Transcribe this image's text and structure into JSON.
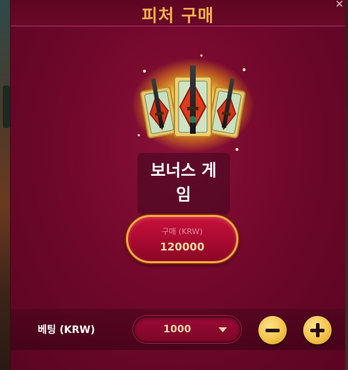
{
  "dialog": {
    "title": "피처 구매",
    "close_glyph": "×"
  },
  "bonus": {
    "name_line1": "보너스 게",
    "name_line2": "임",
    "artwork_icon": "katana-cards-icon"
  },
  "buy": {
    "label": "구매 (KRW)",
    "price": "120000"
  },
  "bet": {
    "label": "베팅 (KRW)",
    "value": "1000",
    "minus_icon": "minus-icon",
    "plus_icon": "plus-icon"
  },
  "colors": {
    "panel": "#72082c",
    "title": "#f6b24a",
    "button_border": "#f0a93c",
    "circle_button": "#f5c34a"
  }
}
